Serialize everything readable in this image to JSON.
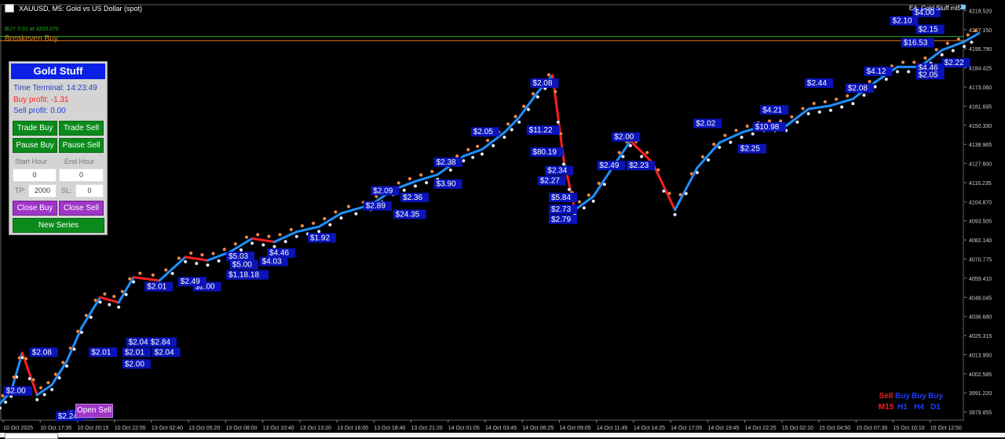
{
  "window": {
    "title": "XAUUSD, M5:  Gold vs US Dollar (spot)",
    "ea_label": "EA: Gold Stuff mt5"
  },
  "chart_overlay": {
    "buy_line_label": "BUY 0.01 at 4203.070",
    "breakeven_label": "Breakeven Buy"
  },
  "panel": {
    "title": "Gold Stuff",
    "time_label": "Time Terminal: 14:23:49",
    "buy_profit": "Buy profit: -1.31",
    "sell_profit": "Sell profit: 0.00",
    "trade_buy": "Trade Buy",
    "trade_sell": "Trade Sell",
    "pause_buy": "Pause Buy",
    "pause_sell": "Pause Sell",
    "start_hour_label": "Start Hour",
    "end_hour_label": "End Hour",
    "start_hour_value": "0",
    "end_hour_value": "0",
    "tp_label": "TP:",
    "tp_value": "2000",
    "sl_label": "SL:",
    "sl_value": "0",
    "close_buy": "Close Buy",
    "close_sell": "Close Sell",
    "new_series": "New Series"
  },
  "open_sell_label": "Open Sell",
  "signals": {
    "top": [
      "Sell",
      "Buy",
      "Buy",
      "Buy"
    ],
    "bottom": [
      "M15",
      "H1",
      "H4",
      "D1"
    ],
    "colors": {
      "sell": "#ff1a1a",
      "buy": "#1f3cff"
    }
  },
  "colors": {
    "up_candle": "#1e90ff",
    "down_candle": "#ff2020",
    "profit_label_bg": "#0a14b8",
    "grid": "#1a1a1a"
  },
  "chart_data": {
    "type": "line",
    "title": "XAUUSD, M5:  Gold vs US Dollar (spot)",
    "y_ticks": [
      "4218.520",
      "4207.150",
      "4195.790",
      "4184.425",
      "4173.060",
      "4161.695",
      "4150.330",
      "4138.965",
      "4127.600",
      "4116.235",
      "4104.870",
      "4093.505",
      "4082.140",
      "4070.775",
      "4059.410",
      "4048.045",
      "4036.680",
      "4025.315",
      "4013.950",
      "4002.585",
      "3991.220",
      "3979.855"
    ],
    "x_ticks": [
      "10 Oct 2025",
      "10 Oct 17:35",
      "10 Oct 20:15",
      "10 Oct 22:55",
      "13 Oct 02:40",
      "13 Oct 05:20",
      "13 Oct 08:00",
      "13 Oct 10:40",
      "13 Oct 13:20",
      "13 Oct 16:00",
      "13 Oct 18:40",
      "13 Oct 21:20",
      "14 Oct 01:05",
      "14 Oct 03:45",
      "14 Oct 06:25",
      "14 Oct 09:05",
      "14 Oct 11:45",
      "14 Oct 14:25",
      "14 Oct 17:05",
      "14 Oct 19:45",
      "14 Oct 22:25",
      "15 Oct 02:10",
      "15 Oct 04:50",
      "15 Oct 07:30",
      "15 Oct 10:10",
      "15 Oct 12:50"
    ],
    "ylim": [
      3975,
      4222
    ],
    "price_path": [
      [
        0,
        3985
      ],
      [
        0.3,
        3992
      ],
      [
        0.6,
        4015
      ],
      [
        1.0,
        3990
      ],
      [
        1.4,
        3996
      ],
      [
        1.8,
        4010
      ],
      [
        2.2,
        4030
      ],
      [
        2.7,
        4048
      ],
      [
        3.2,
        4045
      ],
      [
        3.6,
        4060
      ],
      [
        4.3,
        4058
      ],
      [
        5.0,
        4072
      ],
      [
        5.6,
        4070
      ],
      [
        6.2,
        4075
      ],
      [
        6.8,
        4083
      ],
      [
        7.4,
        4081
      ],
      [
        8.0,
        4087
      ],
      [
        8.6,
        4090
      ],
      [
        9.2,
        4098
      ],
      [
        10.0,
        4103
      ],
      [
        10.6,
        4112
      ],
      [
        11.2,
        4117
      ],
      [
        11.8,
        4121
      ],
      [
        12.5,
        4132
      ],
      [
        13.0,
        4136
      ],
      [
        13.6,
        4146
      ],
      [
        14.0,
        4155
      ],
      [
        14.5,
        4170
      ],
      [
        14.9,
        4180
      ],
      [
        15.2,
        4130
      ],
      [
        15.5,
        4100
      ],
      [
        16.0,
        4108
      ],
      [
        16.6,
        4128
      ],
      [
        17.0,
        4141
      ],
      [
        17.6,
        4128
      ],
      [
        18.2,
        4100
      ],
      [
        18.8,
        4125
      ],
      [
        19.4,
        4140
      ],
      [
        20.0,
        4146
      ],
      [
        20.6,
        4150
      ],
      [
        21.2,
        4150
      ],
      [
        21.8,
        4160
      ],
      [
        22.4,
        4162
      ],
      [
        23.0,
        4166
      ],
      [
        23.6,
        4176
      ],
      [
        24.2,
        4185
      ],
      [
        24.8,
        4185
      ],
      [
        25.4,
        4195
      ],
      [
        26.0,
        4200
      ],
      [
        26.4,
        4205
      ]
    ],
    "profit_labels": [
      {
        "text": "$2.00",
        "x": 0.1,
        "y": 3991
      },
      {
        "text": "$2.08",
        "x": 0.8,
        "y": 4014
      },
      {
        "text": "$2.04",
        "x": 1.8,
        "y": 3977
      },
      {
        "text": "$2.24",
        "x": 1.5,
        "y": 3976
      },
      {
        "text": "$2.01",
        "x": 2.4,
        "y": 4014
      },
      {
        "text": "$2.00",
        "x": 3.3,
        "y": 4007
      },
      {
        "text": "$2.01",
        "x": 3.3,
        "y": 4014
      },
      {
        "text": "$2.04",
        "x": 3.4,
        "y": 4020
      },
      {
        "text": "$2.84",
        "x": 4.0,
        "y": 4020
      },
      {
        "text": "$2.04",
        "x": 4.1,
        "y": 4014
      },
      {
        "text": "$2.01",
        "x": 3.9,
        "y": 4053
      },
      {
        "text": "$2.00",
        "x": 5.2,
        "y": 4053
      },
      {
        "text": "$2.49",
        "x": 4.8,
        "y": 4056
      },
      {
        "text": "$1.18.18",
        "x": 6.1,
        "y": 4060
      },
      {
        "text": "$5.03",
        "x": 6.1,
        "y": 4071
      },
      {
        "text": "$5.00",
        "x": 6.2,
        "y": 4066
      },
      {
        "text": "$4.03",
        "x": 7.0,
        "y": 4068
      },
      {
        "text": "$4.46",
        "x": 7.2,
        "y": 4073
      },
      {
        "text": "$1.92",
        "x": 8.3,
        "y": 4082
      },
      {
        "text": "$2.09",
        "x": 10.0,
        "y": 4110
      },
      {
        "text": "$2.89",
        "x": 9.8,
        "y": 4101
      },
      {
        "text": "$24.35",
        "x": 10.6,
        "y": 4096
      },
      {
        "text": "$2.36",
        "x": 10.8,
        "y": 4106
      },
      {
        "text": "$3.90",
        "x": 11.7,
        "y": 4114
      },
      {
        "text": "$2.38",
        "x": 11.7,
        "y": 4127
      },
      {
        "text": "$2.05",
        "x": 12.7,
        "y": 4145
      },
      {
        "text": "$2.08",
        "x": 14.3,
        "y": 4174
      },
      {
        "text": "$11.22",
        "x": 14.2,
        "y": 4146
      },
      {
        "text": "$80.19",
        "x": 14.3,
        "y": 4133
      },
      {
        "text": "$2.34",
        "x": 14.7,
        "y": 4122
      },
      {
        "text": "$2.27",
        "x": 14.5,
        "y": 4116
      },
      {
        "text": "$5.84",
        "x": 14.8,
        "y": 4106
      },
      {
        "text": "$2.73",
        "x": 14.8,
        "y": 4099
      },
      {
        "text": "$2.79",
        "x": 14.8,
        "y": 4093
      },
      {
        "text": "$2.49",
        "x": 16.1,
        "y": 4125
      },
      {
        "text": "$2.23",
        "x": 16.9,
        "y": 4125
      },
      {
        "text": "$2.00",
        "x": 16.5,
        "y": 4142
      },
      {
        "text": "$2.02",
        "x": 18.7,
        "y": 4150
      },
      {
        "text": "$10.98",
        "x": 20.3,
        "y": 4148
      },
      {
        "text": "$2.25",
        "x": 19.9,
        "y": 4135
      },
      {
        "text": "$4.21",
        "x": 20.5,
        "y": 4158
      },
      {
        "text": "$2.44",
        "x": 21.7,
        "y": 4174
      },
      {
        "text": "$2.08",
        "x": 22.8,
        "y": 4171
      },
      {
        "text": "$4.12",
        "x": 23.3,
        "y": 4181
      },
      {
        "text": "$16.53",
        "x": 24.3,
        "y": 4198
      },
      {
        "text": "$4.46",
        "x": 24.7,
        "y": 4183
      },
      {
        "text": "$2.05",
        "x": 24.7,
        "y": 4179
      },
      {
        "text": "$2.22",
        "x": 25.4,
        "y": 4186
      },
      {
        "text": "$4.00",
        "x": 24.6,
        "y": 4216
      },
      {
        "text": "$2.10",
        "x": 24.0,
        "y": 4211
      },
      {
        "text": "$2.15",
        "x": 24.7,
        "y": 4206
      }
    ],
    "legend": "none",
    "grid": false
  }
}
